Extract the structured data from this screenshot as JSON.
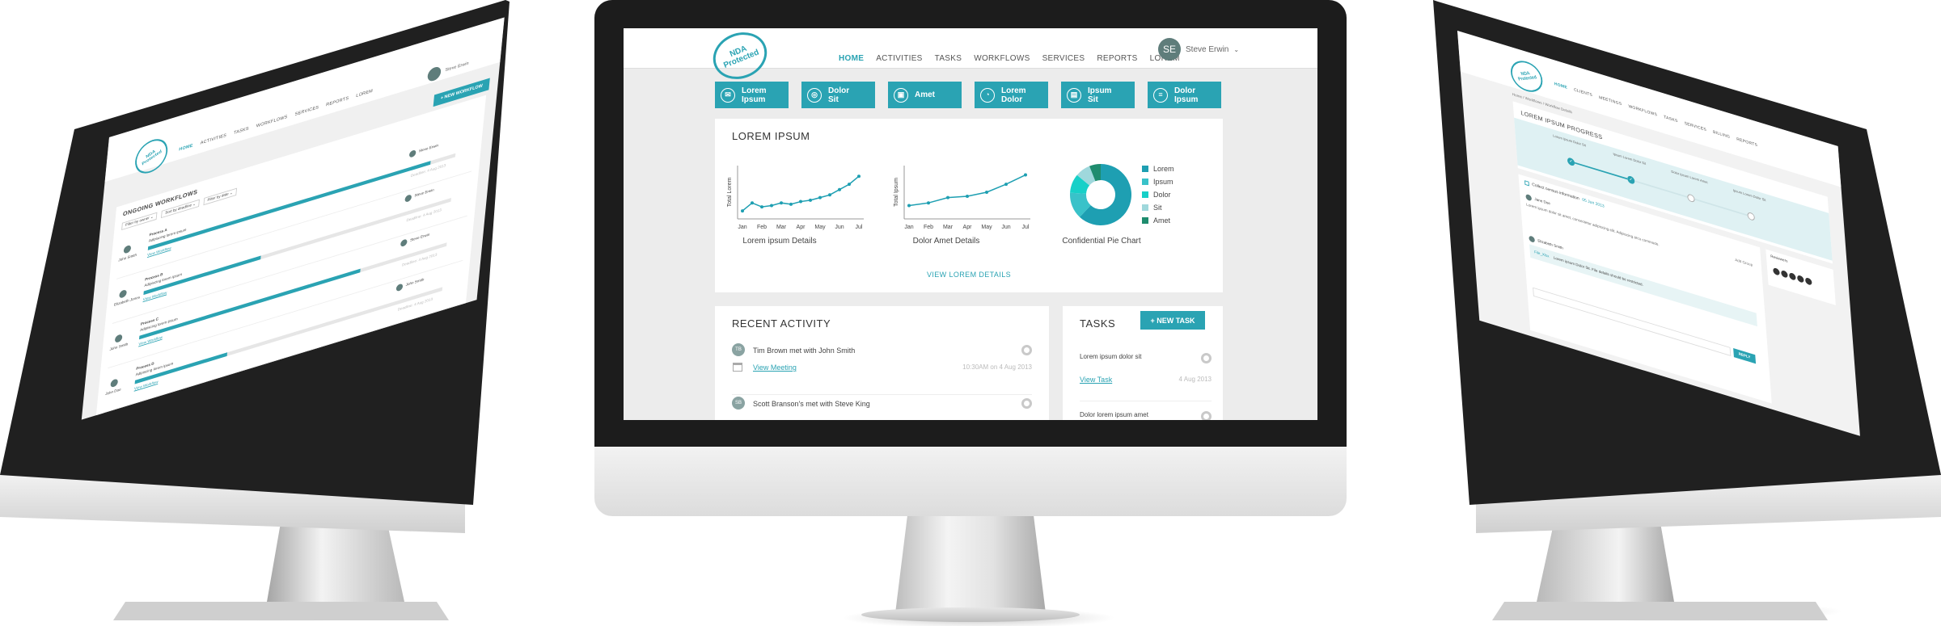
{
  "center": {
    "stamp": {
      "line1": "NDA Protected"
    },
    "nav": [
      "HOME",
      "ACTIVITIES",
      "TASKS",
      "WORKFLOWS",
      "SERVICES",
      "REPORTS",
      "LOREM"
    ],
    "user": {
      "initials": "SE",
      "name": "Steve Erwin"
    },
    "tiles": [
      {
        "l1": "Lorem",
        "l2": "Ipsum",
        "icon": "chat-icon"
      },
      {
        "l1": "Dolor",
        "l2": "Sit",
        "icon": "target-icon"
      },
      {
        "l1": "Amet",
        "l2": "",
        "icon": "box-icon"
      },
      {
        "l1": "Lorem",
        "l2": "Dolor",
        "icon": "gauge-icon"
      },
      {
        "l1": "Ipsum",
        "l2": "Sit",
        "icon": "doc-icon"
      },
      {
        "l1": "Dolor",
        "l2": "Ipsum",
        "icon": "list-icon"
      }
    ],
    "overview": {
      "title": "LOREM IPSUM",
      "link": "VIEW LOREM DETAILS",
      "chart1": {
        "caption": "Lorem ipsum Details",
        "ylabel": "Total Lorem"
      },
      "chart2": {
        "caption": "Dolor Amet Details",
        "ylabel": "Total Ipsum"
      },
      "pie": {
        "caption": "Confidential Pie Chart"
      }
    },
    "activity": {
      "title": "RECENT ACTIVITY",
      "items": [
        {
          "initials": "TB",
          "text": "Tim Brown met with John Smith",
          "link": "View Meeting",
          "time": "10:30AM on 4 Aug 2013"
        },
        {
          "initials": "SB",
          "text": "Scott Branson's met with Steve King",
          "link": "",
          "time": ""
        }
      ]
    },
    "tasks": {
      "title": "TASKS",
      "new_button": "+ NEW TASK",
      "items": [
        {
          "text": "Lorem ipsum dolor sit",
          "link": "View Task",
          "date": "4 Aug 2013"
        },
        {
          "text": "Dolor lorem ipsum amet",
          "link": "",
          "date": ""
        }
      ]
    }
  },
  "chart_data": [
    {
      "type": "line",
      "title": "Lorem ipsum Details",
      "ylabel": "Total Lorem",
      "categories": [
        "Jan",
        "Feb",
        "Mar",
        "Apr",
        "May",
        "Jun",
        "Jul"
      ],
      "x": [
        0,
        0.5,
        1,
        1.5,
        2,
        2.5,
        3,
        3.5,
        4,
        4.5,
        5,
        5.5,
        6
      ],
      "values": [
        3,
        6,
        4.5,
        5,
        6,
        5.5,
        6.5,
        7,
        8,
        9,
        11,
        13,
        16
      ],
      "ylim": [
        0,
        20
      ]
    },
    {
      "type": "line",
      "title": "Dolor Amet Details",
      "ylabel": "Total Ipsum",
      "categories": [
        "Jan",
        "Feb",
        "Mar",
        "Apr",
        "May",
        "Jun",
        "Jul"
      ],
      "x": [
        0,
        1,
        2,
        3,
        4,
        5,
        6
      ],
      "values": [
        5,
        6,
        8,
        8.5,
        10,
        13,
        16.5
      ],
      "ylim": [
        0,
        20
      ]
    },
    {
      "type": "pie",
      "title": "Confidential Pie Chart",
      "labels": [
        "Lorem",
        "Ipsum",
        "Dolor",
        "Sit",
        "Amet"
      ],
      "values": [
        62,
        14,
        10,
        8,
        6
      ],
      "colors": [
        "#1e9fb2",
        "#39c2c9",
        "#17d0c8",
        "#9fd8dc",
        "#1e8c6e"
      ]
    }
  ],
  "left": {
    "stamp": "NDA Protected",
    "nav": [
      "HOME",
      "ACTIVITIES",
      "TASKS",
      "WORKFLOWS",
      "SERVICES",
      "REPORTS",
      "LOREM"
    ],
    "user": "Steve Erwin",
    "new_button": "+ NEW WORKFLOW",
    "title": "ONGOING WORKFLOWS",
    "filters": [
      "Filter by owner",
      "Sort by deadline",
      "Filter by date"
    ],
    "rows": [
      {
        "owner": "John Smith",
        "process": "Process A",
        "sub": "Adipiscing lorem ipsum",
        "link": "View Workflow",
        "assignee": "Steve Erwin",
        "deadline": "Deadline: 4 Aug 2013",
        "progress": 0.92
      },
      {
        "owner": "Elizabeth Jones",
        "process": "Process B",
        "sub": "Adipiscing lorem ipsum",
        "link": "View Workflow",
        "assignee": "Steve Erwin",
        "deadline": "Deadline: 4 Aug 2013",
        "progress": 0.38
      },
      {
        "owner": "John Smith",
        "process": "Process C",
        "sub": "Adipiscing lorem ipsum",
        "link": "View Workflow",
        "assignee": "Steve Erwin",
        "deadline": "Deadline: 4 Aug 2013",
        "progress": 0.72
      },
      {
        "owner": "John Doe",
        "process": "Process D",
        "sub": "Adipiscing lorem ipsum",
        "link": "View Workflow",
        "assignee": "John Smith",
        "deadline": "Deadline: 4 Aug 2013",
        "progress": 0.3
      }
    ]
  },
  "right": {
    "stamp": "NDA Protected",
    "nav": [
      "HOME",
      "CLIENTS",
      "MEETINGS",
      "WORKFLOWS",
      "TASKS",
      "SERVICES",
      "BILLING",
      "REPORTS"
    ],
    "breadcrumb": "Home / Workflows / Workflow Details",
    "title": "LOREM IPSUM PROGRESS",
    "steps": [
      "Lorem Ipsum Dolor Sit",
      "Ipsum Lorem Dolor Sit",
      "Dolor Ipsum Lorem Amet",
      "Ipsum Lorem Dolor Sit"
    ],
    "checkbox": "Collect census information",
    "checkbox_date": "05 Jun 2013",
    "comment1": {
      "author": "Jane Doe",
      "tag": "Add Group",
      "text": "Lorem ipsum dolor sit amet, consectetur adipiscing elit. Adipiscing arcu commodo."
    },
    "comment2": {
      "author": "Elizabeth Smith",
      "text": "Lorem ipsum Dolor Sit. File details should be restricted.",
      "file": "File_Xlsx"
    },
    "reviewers": "Reviewers",
    "reply": "REPLY"
  }
}
